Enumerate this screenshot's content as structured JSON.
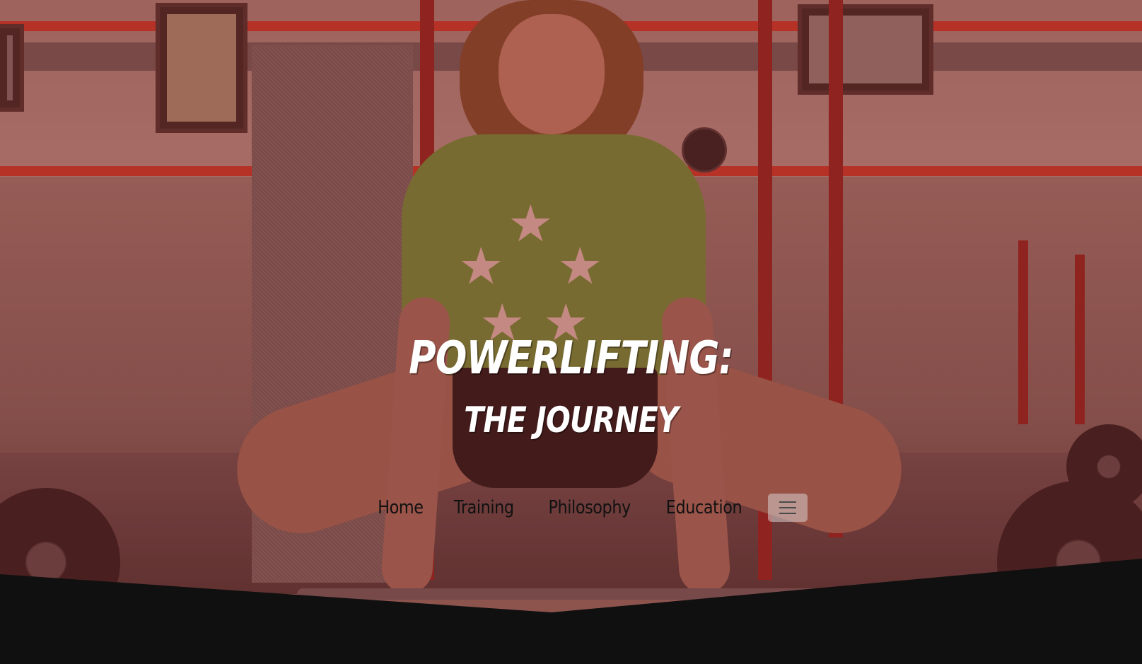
{
  "hero": {
    "title_main": "POWERLIFTING:",
    "title_sub": "THE JOURNEY",
    "overlay_color": "#961e1e"
  },
  "nav": {
    "items": [
      {
        "label": "Home"
      },
      {
        "label": "Training"
      },
      {
        "label": "Philosophy"
      },
      {
        "label": "Education"
      }
    ],
    "menu_icon": "hamburger-menu-icon"
  },
  "colors": {
    "accent": "#ffffff",
    "nav_text": "#111111",
    "bottom_band": "#101010"
  }
}
